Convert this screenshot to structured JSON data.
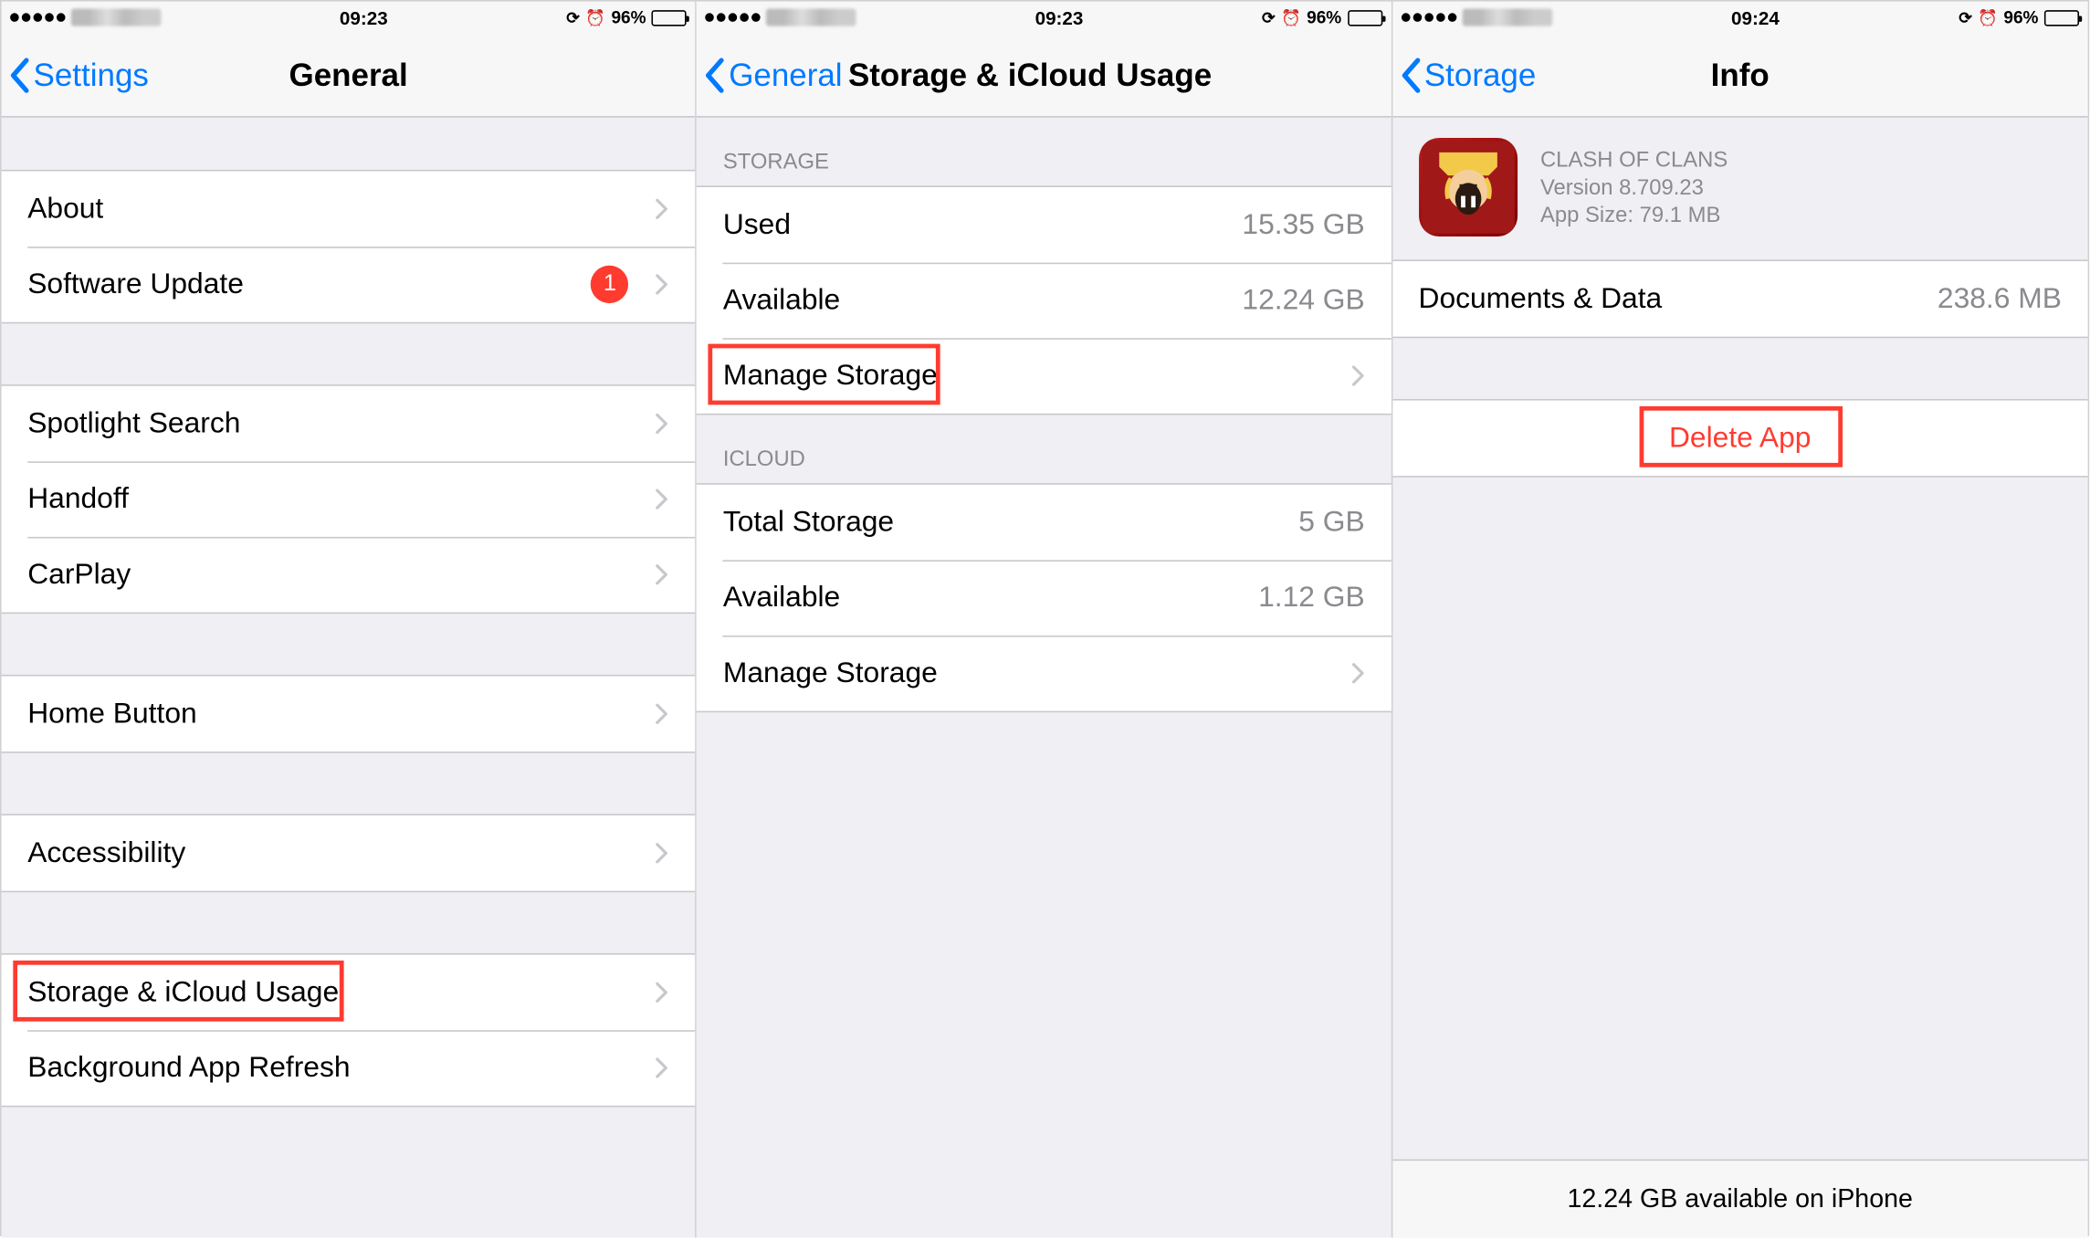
{
  "statusbar": {
    "time1": "09:23",
    "time2": "09:23",
    "time3": "09:24",
    "battery_pct": "96%"
  },
  "screen1": {
    "back": "Settings",
    "title": "General",
    "rows": {
      "about": "About",
      "software_update": "Software Update",
      "software_update_badge": "1",
      "spotlight": "Spotlight Search",
      "handoff": "Handoff",
      "carplay": "CarPlay",
      "home_button": "Home Button",
      "accessibility": "Accessibility",
      "storage_icloud": "Storage & iCloud Usage",
      "background_refresh": "Background App Refresh"
    }
  },
  "screen2": {
    "back": "General",
    "title": "Storage & iCloud Usage",
    "section_storage": "Storage",
    "section_icloud": "iCloud",
    "rows": {
      "used_label": "Used",
      "used_value": "15.35 GB",
      "available_label": "Available",
      "available_value": "12.24 GB",
      "manage_storage": "Manage Storage",
      "total_storage_label": "Total Storage",
      "total_storage_value": "5 GB",
      "icloud_available_label": "Available",
      "icloud_available_value": "1.12 GB",
      "icloud_manage": "Manage Storage"
    }
  },
  "screen3": {
    "back": "Storage",
    "title": "Info",
    "app": {
      "name": "Clash of Clans",
      "version_line": "Version 8.709.23",
      "size_line": "App Size: 79.1 MB"
    },
    "rows": {
      "docs_label": "Documents & Data",
      "docs_value": "238.6 MB",
      "delete": "Delete App"
    },
    "footer": "12.24 GB available on iPhone"
  }
}
